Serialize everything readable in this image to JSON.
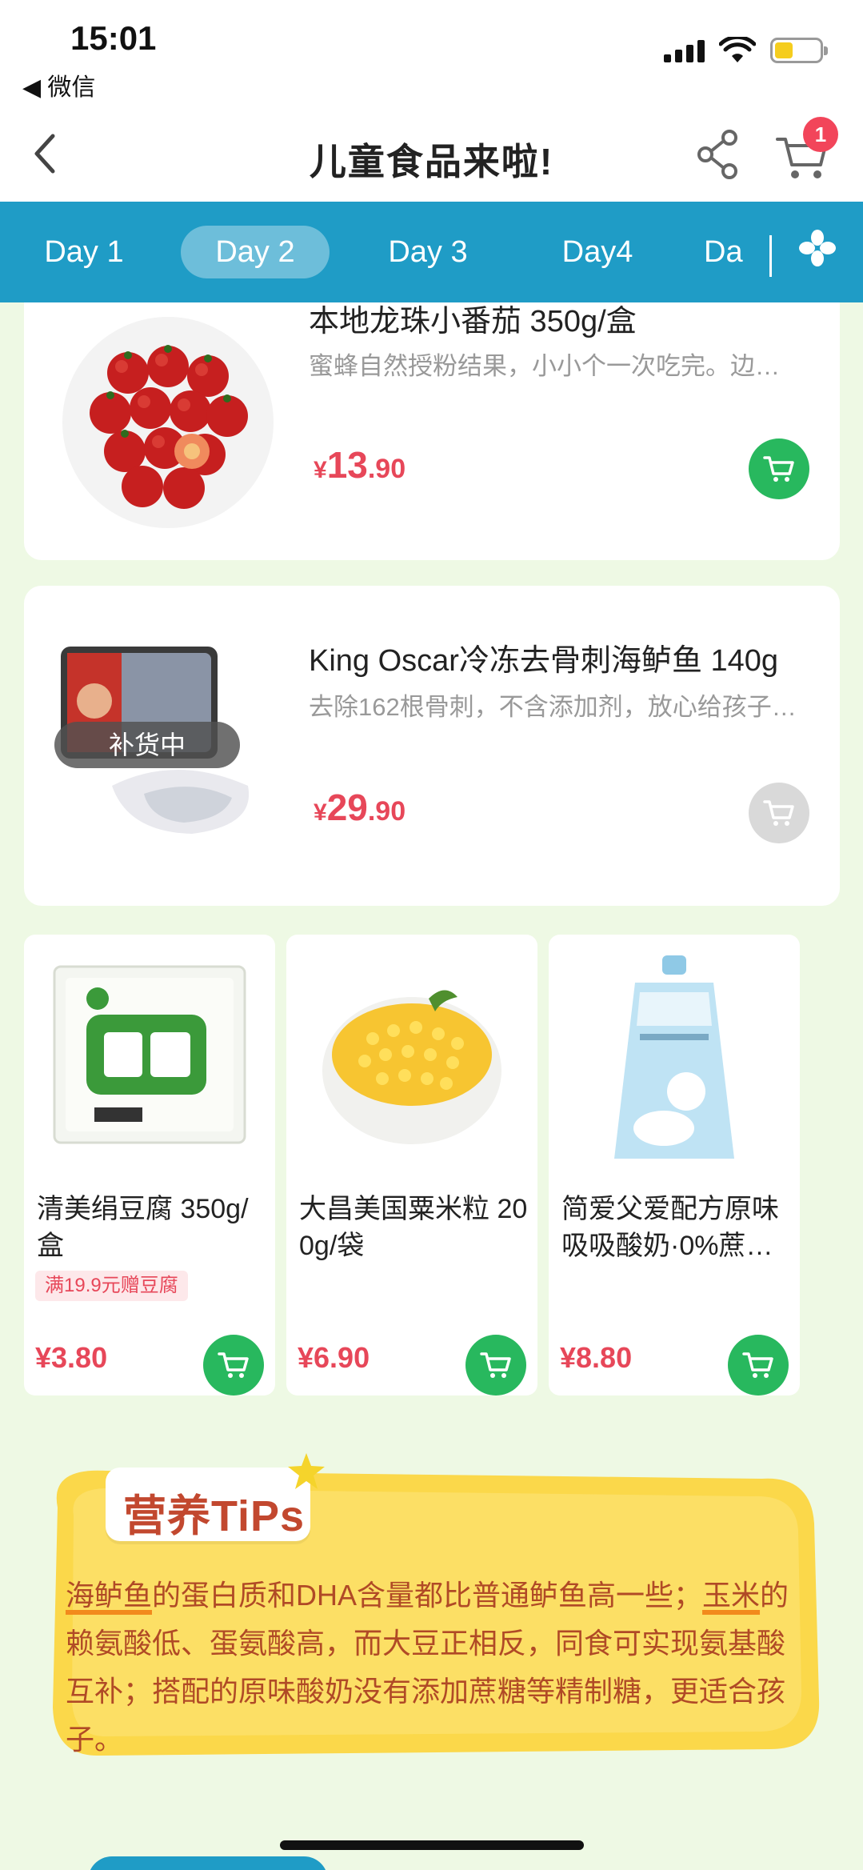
{
  "status_bar": {
    "time": "15:01",
    "back_app": "◀ 微信"
  },
  "navbar": {
    "title": "儿童食品来啦!",
    "cart_count": "1"
  },
  "day_tabs": [
    "Day 1",
    "Day 2",
    "Day 3",
    "Day4",
    "Da"
  ],
  "active_day": "Day 2",
  "products_list": [
    {
      "title": "本地龙珠小番茄 350g/盒",
      "desc": "蜜蜂自然授粉结果，小小个一次吃完。边…",
      "yen": "¥",
      "price_int": "13",
      "price_dec": ".90",
      "available": true
    },
    {
      "title": "King Oscar冷冻去骨刺海鲈鱼 140g",
      "desc": "去除162根骨刺，不含添加剂，放心给孩子…",
      "yen": "¥",
      "price_int": "29",
      "price_dec": ".90",
      "available": false,
      "overlay": "补货中"
    }
  ],
  "products_grid": [
    {
      "title": "清美绢豆腐 350g/盒",
      "promo": "满19.9元赠豆腐",
      "price": "¥3.80"
    },
    {
      "title": "大昌美国粟米粒 200g/袋",
      "price": "¥6.90"
    },
    {
      "title": "简爱父爱配方原味吸吸酸奶·0%蔗…",
      "price": "¥8.80"
    }
  ],
  "tips": {
    "label": "营养TiPs",
    "hl1": "海鲈鱼",
    "seg1": "的蛋白质和DHA含量都比普通鲈鱼高一些；",
    "hl2": "玉米",
    "seg2": "的赖氨酸低、蛋氨酸高，而大豆正相反，同食可实现氨基酸互补；搭配的原味酸奶没有添加蔗糖等精制糖，更适合孩子。"
  },
  "colors": {
    "accent": "#1f9cc6",
    "price": "#e74759",
    "cart": "#28b85e",
    "background": "#eef9e4",
    "tips_bg": "#fbd84a"
  },
  "icons": [
    "back-arrow-icon",
    "share-icon",
    "cart-icon",
    "grid-menu-icon",
    "add-to-cart-icon",
    "star-icon"
  ]
}
